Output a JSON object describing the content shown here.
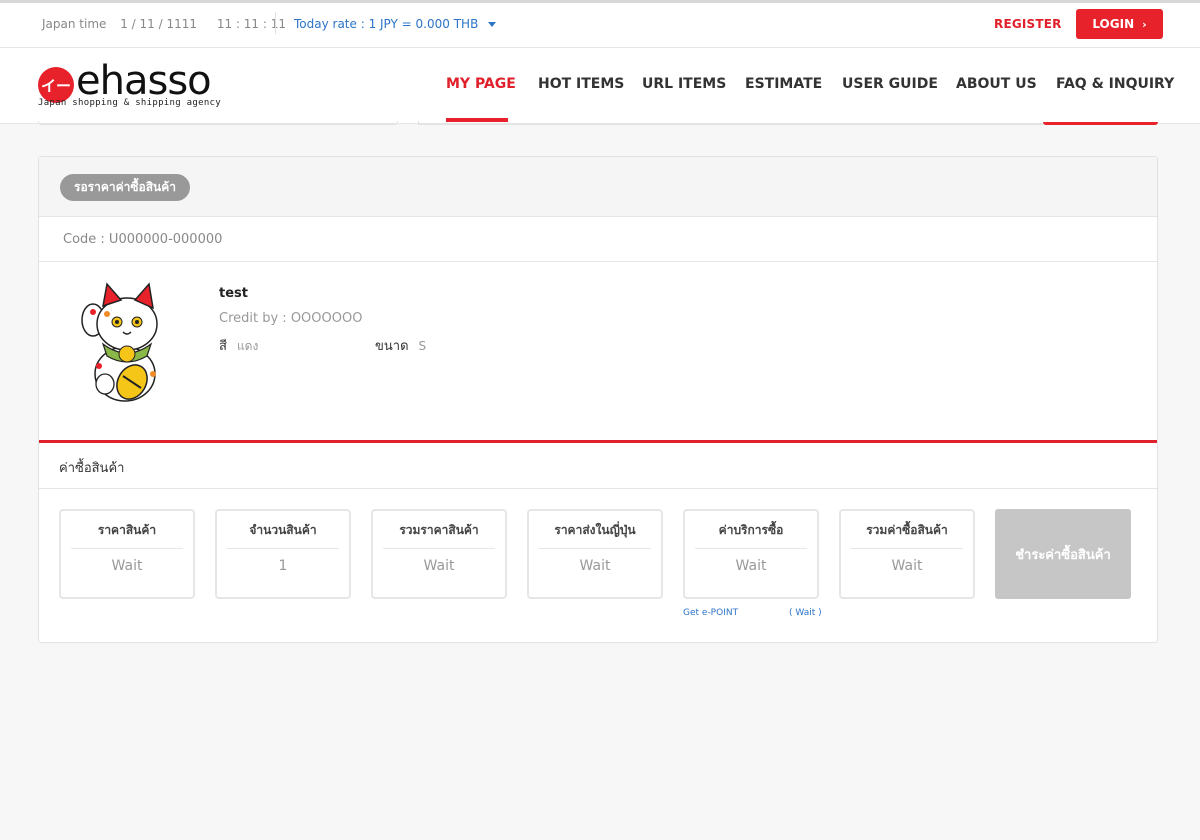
{
  "topbar": {
    "japan_time_label": "Japan time",
    "date": "1 / 11 / 1111",
    "time": "11 : 11 : 11",
    "rate": "Today rate : 1 JPY = 0.000 THB",
    "register": "REGISTER",
    "login": "LOGIN",
    "login_chevron": "›"
  },
  "logo": {
    "mark": "イー",
    "name": "ehasso",
    "tagline": "Japan shopping & shipping agency"
  },
  "nav": {
    "items": [
      "MY PAGE",
      "HOT ITEMS",
      "URL ITEMS",
      "ESTIMATE",
      "USER GUIDE",
      "ABOUT US",
      "FAQ & INQUIRY"
    ],
    "active": "MY PAGE"
  },
  "order": {
    "status": "รอราคาค่าซื้อสินค้า",
    "code": "Code : U000000-000000",
    "product": {
      "title": "test",
      "credit_label": "Credit by : ",
      "credit_value": "OOOOOOO",
      "color_label": "สี",
      "color_value": "แดง",
      "size_label": "ขนาด",
      "size_value": "S",
      "image": "maneki-neko-icon"
    }
  },
  "costs": {
    "section_title": "ค่าซื้อสินค้า",
    "boxes": [
      {
        "label": "ราคาสินค้า",
        "value": "Wait"
      },
      {
        "label": "จำนวนสินค้า",
        "value": "1"
      },
      {
        "label": "รวมราคาสินค้า",
        "value": "Wait"
      },
      {
        "label": "ราคาส่งในญี่ปุ่น",
        "value": "Wait"
      },
      {
        "label": "ค่าบริการซื้อ",
        "value": "Wait"
      },
      {
        "label": "รวมค่าซื้อสินค้า",
        "value": "Wait"
      }
    ],
    "pay_button": "ชำระค่าซื้อสินค้า",
    "epoint_label": "Get e-POINT",
    "epoint_value": "( Wait )"
  },
  "colors": {
    "accent": "#e8222b",
    "link": "#2b74c7",
    "muted": "#999999",
    "disabled_button": "#c6c6c6"
  }
}
